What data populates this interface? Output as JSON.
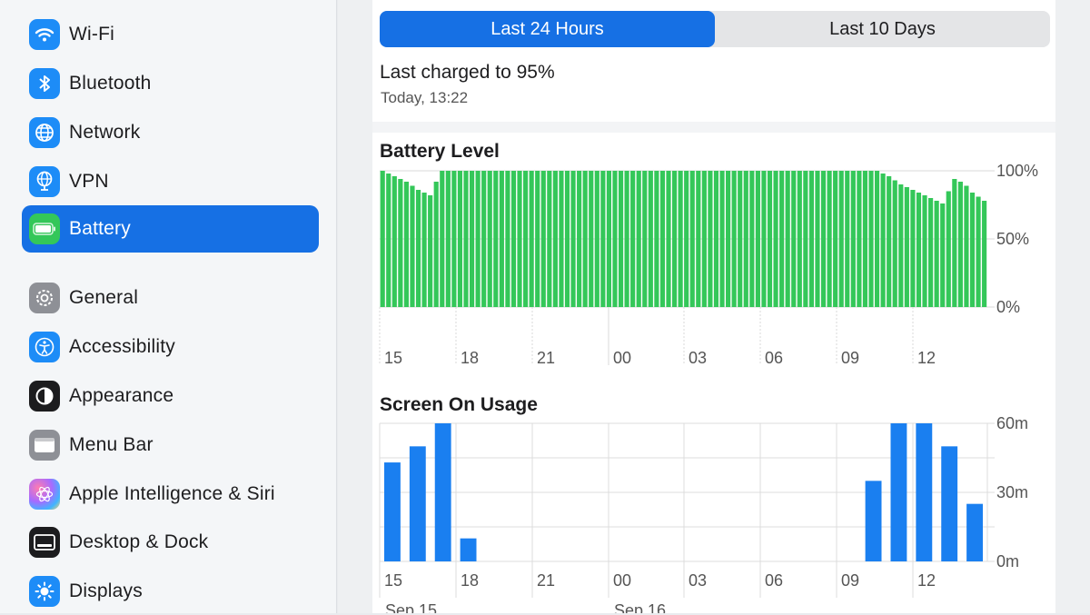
{
  "sidebar": {
    "items": [
      {
        "label": "Wi-Fi",
        "icon": "wifi-icon",
        "color": "#1d8cf7"
      },
      {
        "label": "Bluetooth",
        "icon": "bluetooth-icon",
        "color": "#1d8cf7"
      },
      {
        "label": "Network",
        "icon": "globe-icon",
        "color": "#1d8cf7"
      },
      {
        "label": "VPN",
        "icon": "vpn-globe-icon",
        "color": "#1d8cf7"
      },
      {
        "label": "Battery",
        "icon": "battery-icon",
        "color": "#34c759",
        "selected": true
      },
      {
        "label": "General",
        "icon": "gear-icon",
        "color": "#8e9096"
      },
      {
        "label": "Accessibility",
        "icon": "accessibility-icon",
        "color": "#1d8cf7"
      },
      {
        "label": "Appearance",
        "icon": "appearance-icon",
        "color": "#1c1c1e"
      },
      {
        "label": "Menu Bar",
        "icon": "menu-bar-icon",
        "color": "#8e9096"
      },
      {
        "label": "Apple Intelligence & Siri",
        "icon": "siri-icon",
        "color": "#a66bff"
      },
      {
        "label": "Desktop & Dock",
        "icon": "dock-icon",
        "color": "#1c1c1e"
      },
      {
        "label": "Displays",
        "icon": "sun-icon",
        "color": "#1d8cf7"
      }
    ]
  },
  "segmented": {
    "options": [
      "Last 24 Hours",
      "Last 10 Days"
    ],
    "selected": "Last 24 Hours"
  },
  "status": {
    "charged": "Last charged to 95%",
    "time": "Today, 13:22"
  },
  "colors": {
    "accent": "#1670e4",
    "battery_bar": "#34c759",
    "usage_bar": "#1a7ff0"
  },
  "chart_data": [
    {
      "type": "bar",
      "title": "Battery Level",
      "x_ticks": [
        "15",
        "18",
        "21",
        "00",
        "03",
        "06",
        "09",
        "12"
      ],
      "y_ticks": [
        "100%",
        "50%",
        "0%"
      ],
      "ylim": [
        0,
        100
      ],
      "unit": "%",
      "values": [
        100,
        98,
        96,
        94,
        92,
        89,
        86,
        84,
        82,
        92,
        100,
        100,
        100,
        100,
        100,
        100,
        100,
        100,
        100,
        100,
        100,
        100,
        100,
        100,
        100,
        100,
        100,
        100,
        100,
        100,
        100,
        100,
        100,
        100,
        100,
        100,
        100,
        100,
        100,
        100,
        100,
        100,
        100,
        100,
        100,
        100,
        100,
        100,
        100,
        100,
        100,
        100,
        100,
        100,
        100,
        100,
        100,
        100,
        100,
        100,
        100,
        100,
        100,
        100,
        100,
        100,
        100,
        100,
        100,
        100,
        100,
        100,
        100,
        100,
        100,
        100,
        100,
        100,
        100,
        100,
        100,
        100,
        100,
        100,
        98,
        96,
        93,
        90,
        88,
        86,
        84,
        82,
        80,
        78,
        76,
        85,
        94,
        92,
        89,
        84,
        81,
        78
      ]
    },
    {
      "type": "bar",
      "title": "Screen On Usage",
      "x_ticks": [
        "15",
        "18",
        "21",
        "00",
        "03",
        "06",
        "09",
        "12"
      ],
      "y_ticks": [
        "60m",
        "30m",
        "0m"
      ],
      "ylim": [
        0,
        60
      ],
      "unit": "m",
      "hours": [
        "14",
        "15",
        "16",
        "17",
        "18",
        "19",
        "20",
        "21",
        "22",
        "23",
        "00",
        "01",
        "02",
        "03",
        "04",
        "05",
        "06",
        "07",
        "08",
        "09",
        "10",
        "11",
        "12",
        "13"
      ],
      "values": [
        43,
        50,
        60,
        10,
        0,
        0,
        0,
        0,
        0,
        0,
        0,
        0,
        0,
        0,
        0,
        0,
        0,
        0,
        0,
        35,
        60,
        60,
        50,
        25
      ],
      "date_labels": [
        "Sep 15",
        "Sep 16"
      ]
    }
  ]
}
